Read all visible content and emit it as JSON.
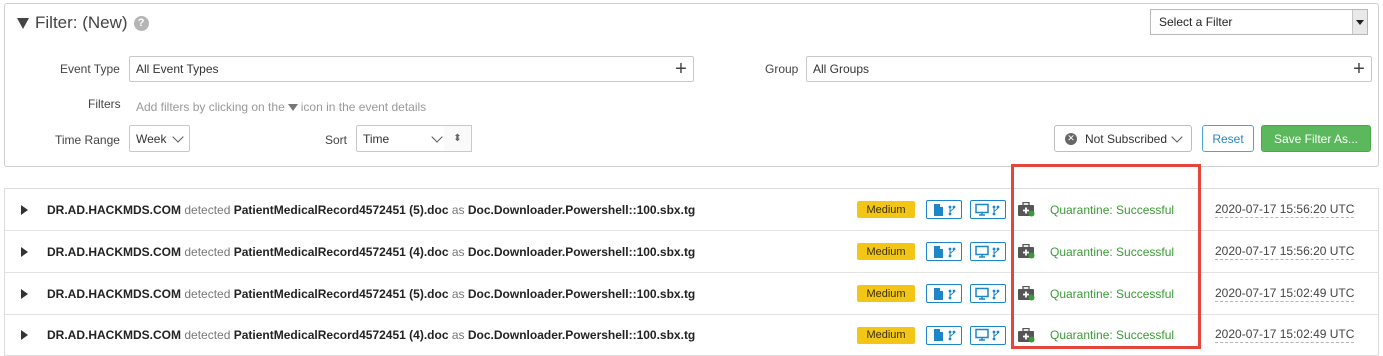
{
  "filter": {
    "title": "Filter: (New)",
    "help_glyph": "?",
    "select_filter": "Select a Filter",
    "event_type_label": "Event Type",
    "event_type_value": "All Event Types",
    "group_label": "Group",
    "group_value": "All Groups",
    "filters_label": "Filters",
    "filters_hint_pre": "Add filters by clicking on the",
    "filters_hint_post": "icon in the event details",
    "time_range_label": "Time Range",
    "time_range_value": "Week",
    "sort_label": "Sort",
    "sort_value": "Time",
    "subscription": "Not Subscribed",
    "reset": "Reset",
    "save": "Save Filter As..."
  },
  "events": [
    {
      "host": "DR.AD.HACKMDS.COM",
      "verb": "detected",
      "file": "PatientMedicalRecord4572451 (5).doc",
      "as": "as",
      "threat": "Doc.Downloader.Powershell::100.sbx.tg",
      "severity": "Medium",
      "status": "Quarantine: Successful",
      "timestamp": "2020-07-17 15:56:20 UTC"
    },
    {
      "host": "DR.AD.HACKMDS.COM",
      "verb": "detected",
      "file": "PatientMedicalRecord4572451 (4).doc",
      "as": "as",
      "threat": "Doc.Downloader.Powershell::100.sbx.tg",
      "severity": "Medium",
      "status": "Quarantine: Successful",
      "timestamp": "2020-07-17 15:56:20 UTC"
    },
    {
      "host": "DR.AD.HACKMDS.COM",
      "verb": "detected",
      "file": "PatientMedicalRecord4572451 (5).doc",
      "as": "as",
      "threat": "Doc.Downloader.Powershell::100.sbx.tg",
      "severity": "Medium",
      "status": "Quarantine: Successful",
      "timestamp": "2020-07-17 15:02:49 UTC"
    },
    {
      "host": "DR.AD.HACKMDS.COM",
      "verb": "detected",
      "file": "PatientMedicalRecord4572451 (4).doc",
      "as": "as",
      "threat": "Doc.Downloader.Powershell::100.sbx.tg",
      "severity": "Medium",
      "status": "Quarantine: Successful",
      "timestamp": "2020-07-17 15:02:49 UTC"
    }
  ],
  "colors": {
    "accent": "#1d86c8",
    "success": "#3a9a35",
    "badge": "#f2c516",
    "save": "#5cb85c",
    "highlight": "#e5453b"
  }
}
